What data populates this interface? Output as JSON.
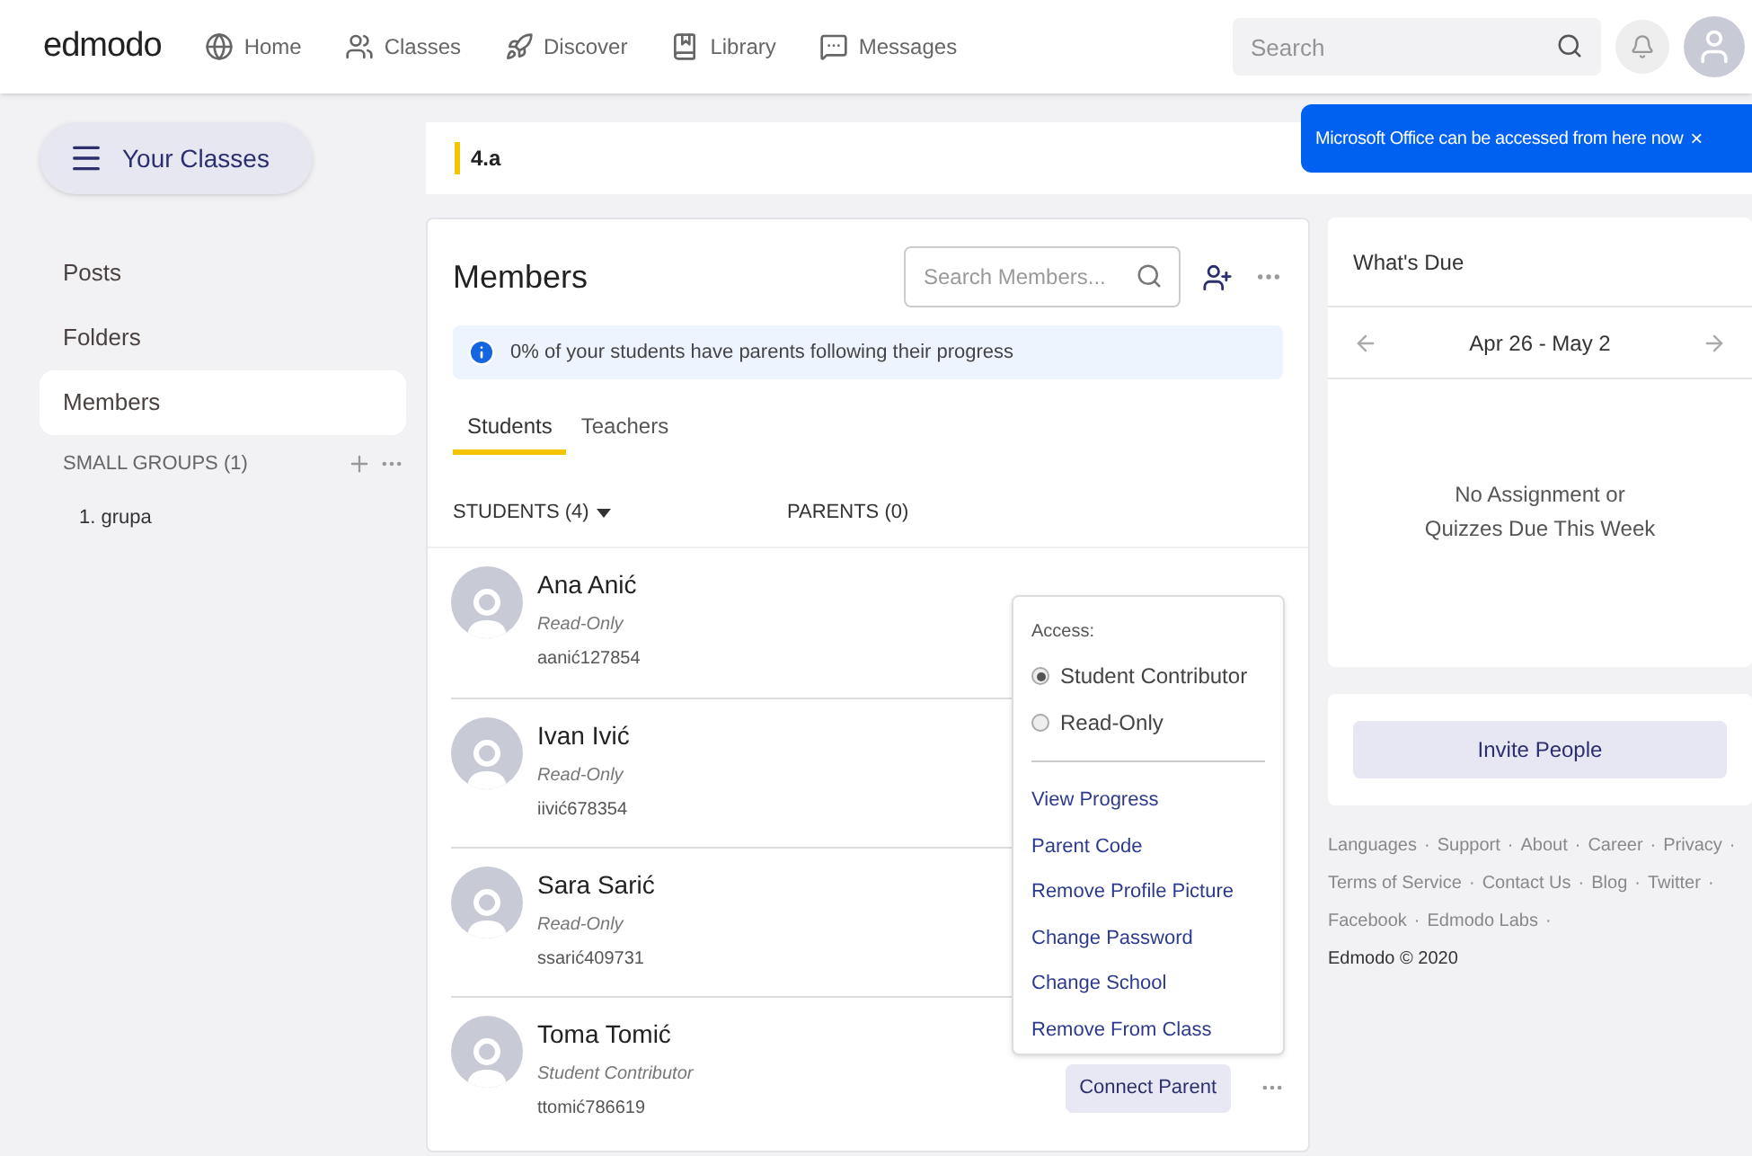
{
  "nav": {
    "logo": "edmodo",
    "items": [
      {
        "kind": "home",
        "label": "Home"
      },
      {
        "kind": "classes",
        "label": "Classes"
      },
      {
        "kind": "discover",
        "label": "Discover"
      },
      {
        "kind": "library",
        "label": "Library"
      },
      {
        "kind": "messages",
        "label": "Messages"
      }
    ],
    "search": {
      "placeholder": "Search"
    }
  },
  "tooltip": {
    "text": "Microsoft Office can be accessed from here now",
    "close": "×"
  },
  "sidebar": {
    "button": "Your Classes",
    "items": [
      {
        "label": "Posts",
        "selected": false
      },
      {
        "label": "Folders",
        "selected": false
      },
      {
        "label": "Members",
        "selected": true
      }
    ],
    "groups_heading": "SMALL GROUPS (1)",
    "groups": [
      "1. grupa"
    ]
  },
  "class_title": "4.a",
  "members": {
    "title": "Members",
    "search": {
      "placeholder": "Search Members..."
    },
    "info": "0% of your students have parents following their progress",
    "tabs": [
      {
        "label": "Students",
        "selected": true
      },
      {
        "label": "Teachers",
        "selected": false
      }
    ],
    "columns": [
      "STUDENTS (4)",
      "PARENTS (0)"
    ],
    "rows": [
      {
        "name": "Ana Anić",
        "role": "Read-Only",
        "username": "aanić127854"
      },
      {
        "name": "Ivan Ivić",
        "role": "Read-Only",
        "username": "iivić678354"
      },
      {
        "name": "Sara Sarić",
        "role": "Read-Only",
        "username": "ssarić409731"
      },
      {
        "name": "Toma Tomić",
        "role": "Student Contributor",
        "username": "ttomić786619",
        "action": "Connect Parent"
      }
    ],
    "menu": {
      "heading": "Access:",
      "options": [
        {
          "label": "Student Contributor",
          "selected": true
        },
        {
          "label": "Read-Only",
          "selected": false
        }
      ],
      "links": [
        "View Progress",
        "Parent Code",
        "Remove Profile Picture",
        "Change Password",
        "Change School",
        "Remove From Class"
      ]
    }
  },
  "whats_due": {
    "title": "What's Due",
    "range": "Apr 26 - May 2",
    "empty": [
      "No Assignment or",
      "Quizzes Due This Week"
    ]
  },
  "invite": "Invite People",
  "footer": {
    "separator": "·",
    "lines": [
      [
        "Languages",
        "Support",
        "About",
        "Career",
        "Privacy"
      ],
      [
        "Terms of Service",
        "Contact Us",
        "Blog",
        "Twitter"
      ],
      [
        "Facebook",
        "Edmodo Labs"
      ]
    ],
    "copyright": "Edmodo © 2020"
  }
}
